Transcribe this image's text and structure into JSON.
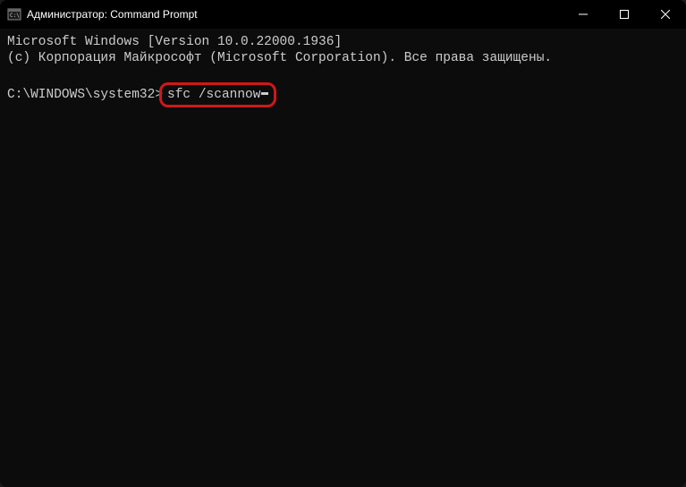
{
  "window": {
    "title": "Администратор: Command Prompt"
  },
  "terminal": {
    "line1": "Microsoft Windows [Version 10.0.22000.1936]",
    "line2": "(c) Корпорация Майкрософт (Microsoft Corporation). Все права защищены.",
    "prompt": "C:\\WINDOWS\\system32>",
    "command": "sfc /scannow"
  }
}
